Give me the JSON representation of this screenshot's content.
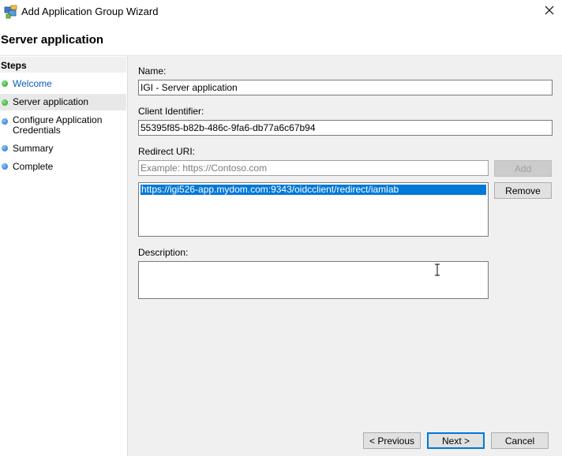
{
  "window": {
    "title": "Add Application Group Wizard",
    "icon": "app-group-icon",
    "close_icon": "close-icon"
  },
  "page": {
    "title": "Server application"
  },
  "sidebar": {
    "header": "Steps",
    "items": [
      {
        "label": "Welcome",
        "status": "complete",
        "dot_color": "#1e9e1e"
      },
      {
        "label": "Server application",
        "status": "current",
        "dot_color": "#1e9e1e"
      },
      {
        "label": "Configure Application Credentials",
        "status": "pending",
        "dot_color": "#1a6fcf"
      },
      {
        "label": "Summary",
        "status": "pending",
        "dot_color": "#1a6fcf"
      },
      {
        "label": "Complete",
        "status": "pending",
        "dot_color": "#1a6fcf"
      }
    ]
  },
  "form": {
    "name_label": "Name:",
    "name_value": "IGI - Server application",
    "client_id_label": "Client Identifier:",
    "client_id_value": "55395f85-b82b-486c-9fa6-db77a6c67b94",
    "redirect_label": "Redirect URI:",
    "redirect_placeholder": "Example: https://Contoso.com",
    "add_button": "Add",
    "remove_button": "Remove",
    "redirect_uris": [
      "https://igi526-app.mydom.com:9343/oidcclient/redirect/iamlab"
    ],
    "description_label": "Description:",
    "description_value": ""
  },
  "footer": {
    "previous": "< Previous",
    "next": "Next >",
    "cancel": "Cancel"
  },
  "colors": {
    "accent": "#0078d7",
    "link": "#0b5bbf"
  }
}
